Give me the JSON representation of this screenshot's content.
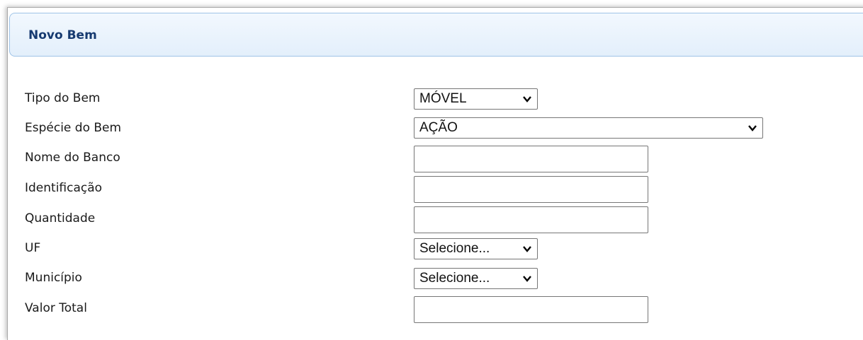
{
  "panel": {
    "title": "Novo Bem"
  },
  "form": {
    "tipo_do_bem": {
      "label": "Tipo do Bem",
      "value": "MÓVEL"
    },
    "especie_do_bem": {
      "label": "Espécie do Bem",
      "value": "AÇÃO"
    },
    "nome_do_banco": {
      "label": "Nome do Banco",
      "value": ""
    },
    "identificacao": {
      "label": "Identificação",
      "value": ""
    },
    "quantidade": {
      "label": "Quantidade",
      "value": ""
    },
    "uf": {
      "label": "UF",
      "value": "Selecione..."
    },
    "municipio": {
      "label": "Município",
      "value": "Selecione..."
    },
    "valor_total": {
      "label": "Valor Total",
      "value": ""
    }
  },
  "icons": {
    "dropdown": "chevron-down-icon"
  }
}
